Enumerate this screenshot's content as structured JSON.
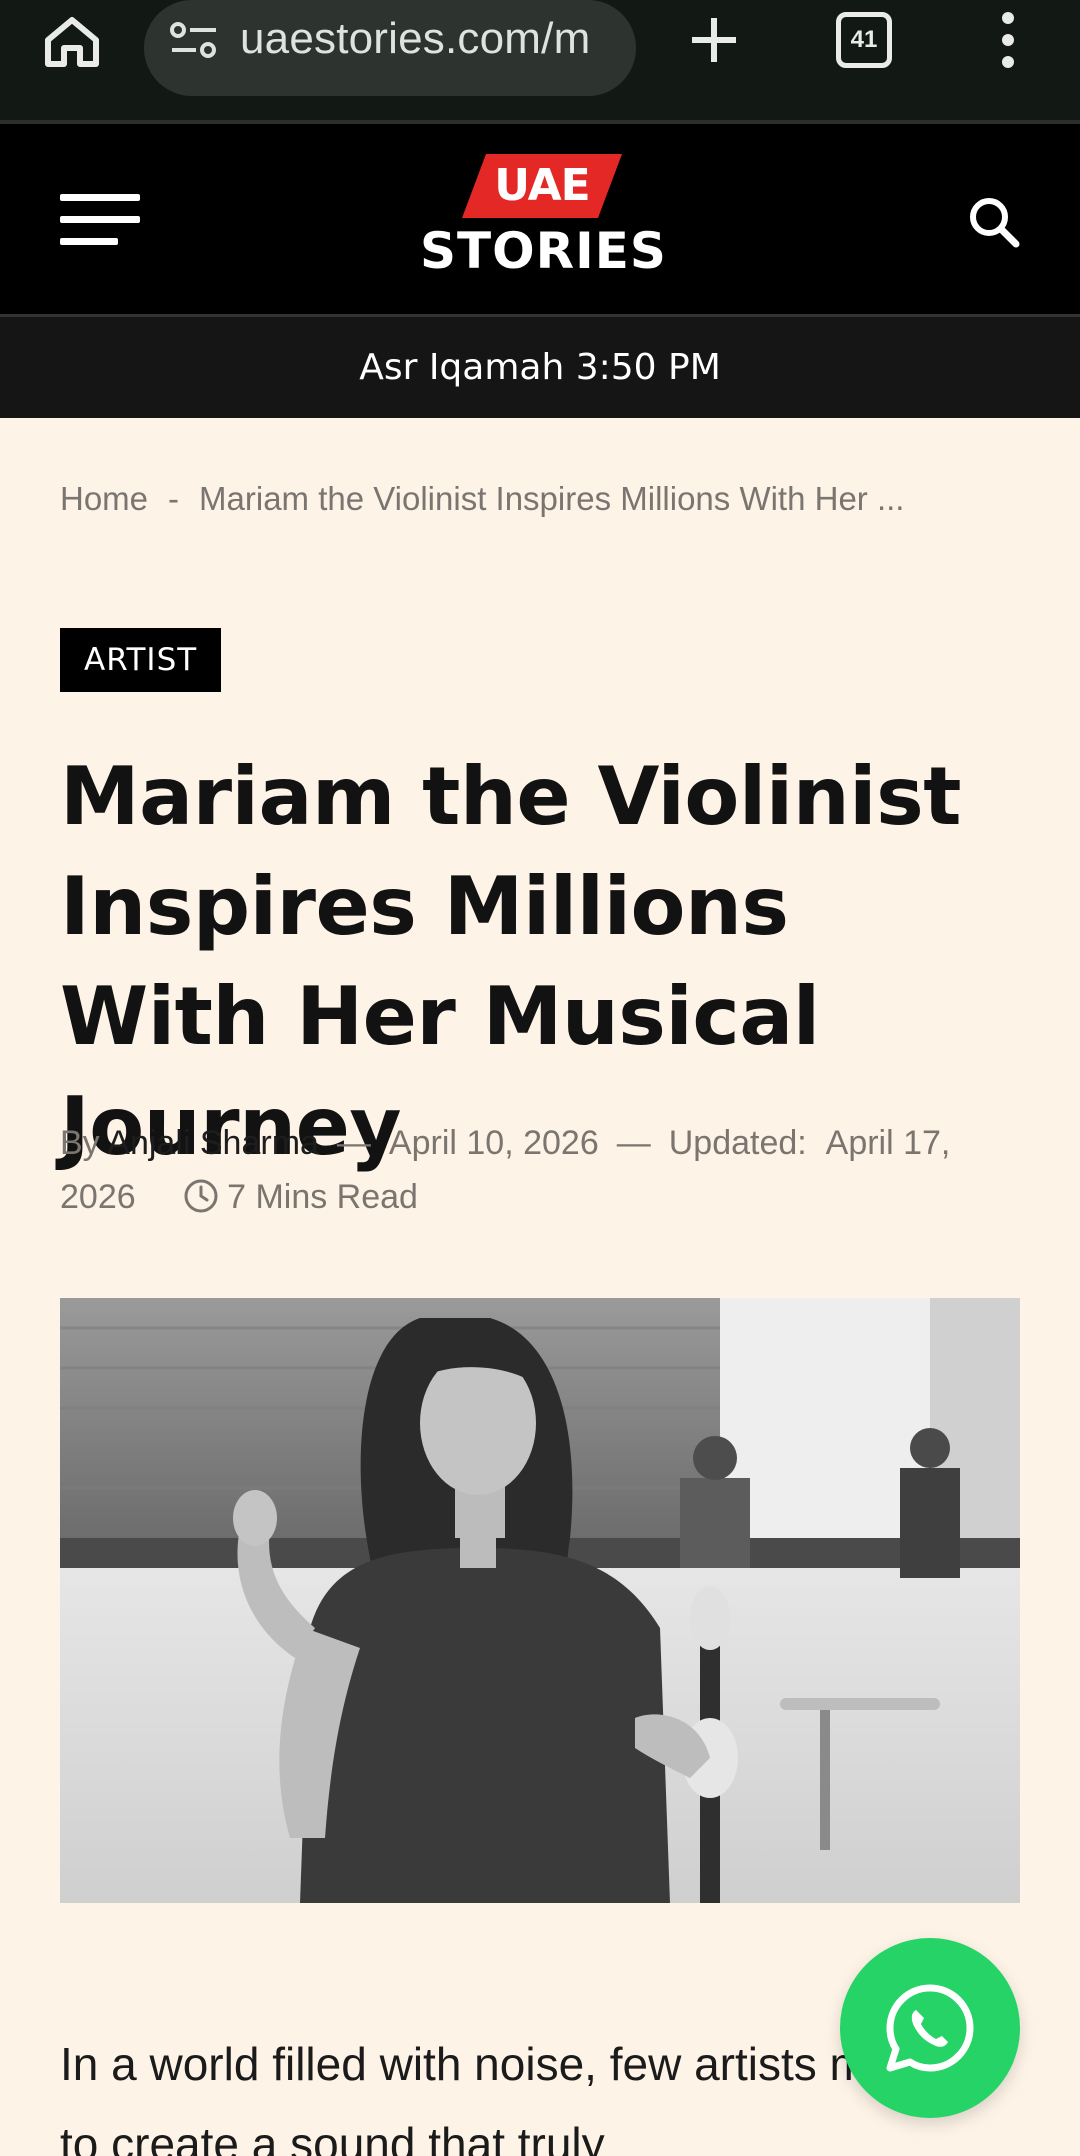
{
  "browser": {
    "url": "uaestories.com/m",
    "tab_count": "41"
  },
  "site": {
    "logo_top": "UAE",
    "logo_bottom": "STORIES",
    "prayer_time": "Asr Iqamah 3:50 PM",
    "colors": {
      "accent": "#e32826",
      "header_bg": "#000000",
      "page_bg": "#fdf3e7",
      "whatsapp": "#25d366"
    }
  },
  "breadcrumb": {
    "home": "Home",
    "separator": "-",
    "current": "Mariam the Violinist Inspires Millions With Her ..."
  },
  "article": {
    "category": "ARTIST",
    "title": "Mariam the Violinist Inspires Millions With Her Musical Journey",
    "by_label": "By",
    "author": "Anjali Sharma",
    "date": "April 10, 2026",
    "updated_label": "Updated:",
    "updated_date": "April 17, 2026",
    "read_time": "7 Mins Read",
    "body_intro": "In a world filled with noise, few artists manage to create a sound that truly"
  },
  "icons": {
    "home": "home-icon",
    "site_settings": "tune-icon",
    "new_tab": "plus-icon",
    "menu": "hamburger-icon",
    "search": "search-icon",
    "clock": "clock-icon",
    "whatsapp": "whatsapp-icon"
  }
}
